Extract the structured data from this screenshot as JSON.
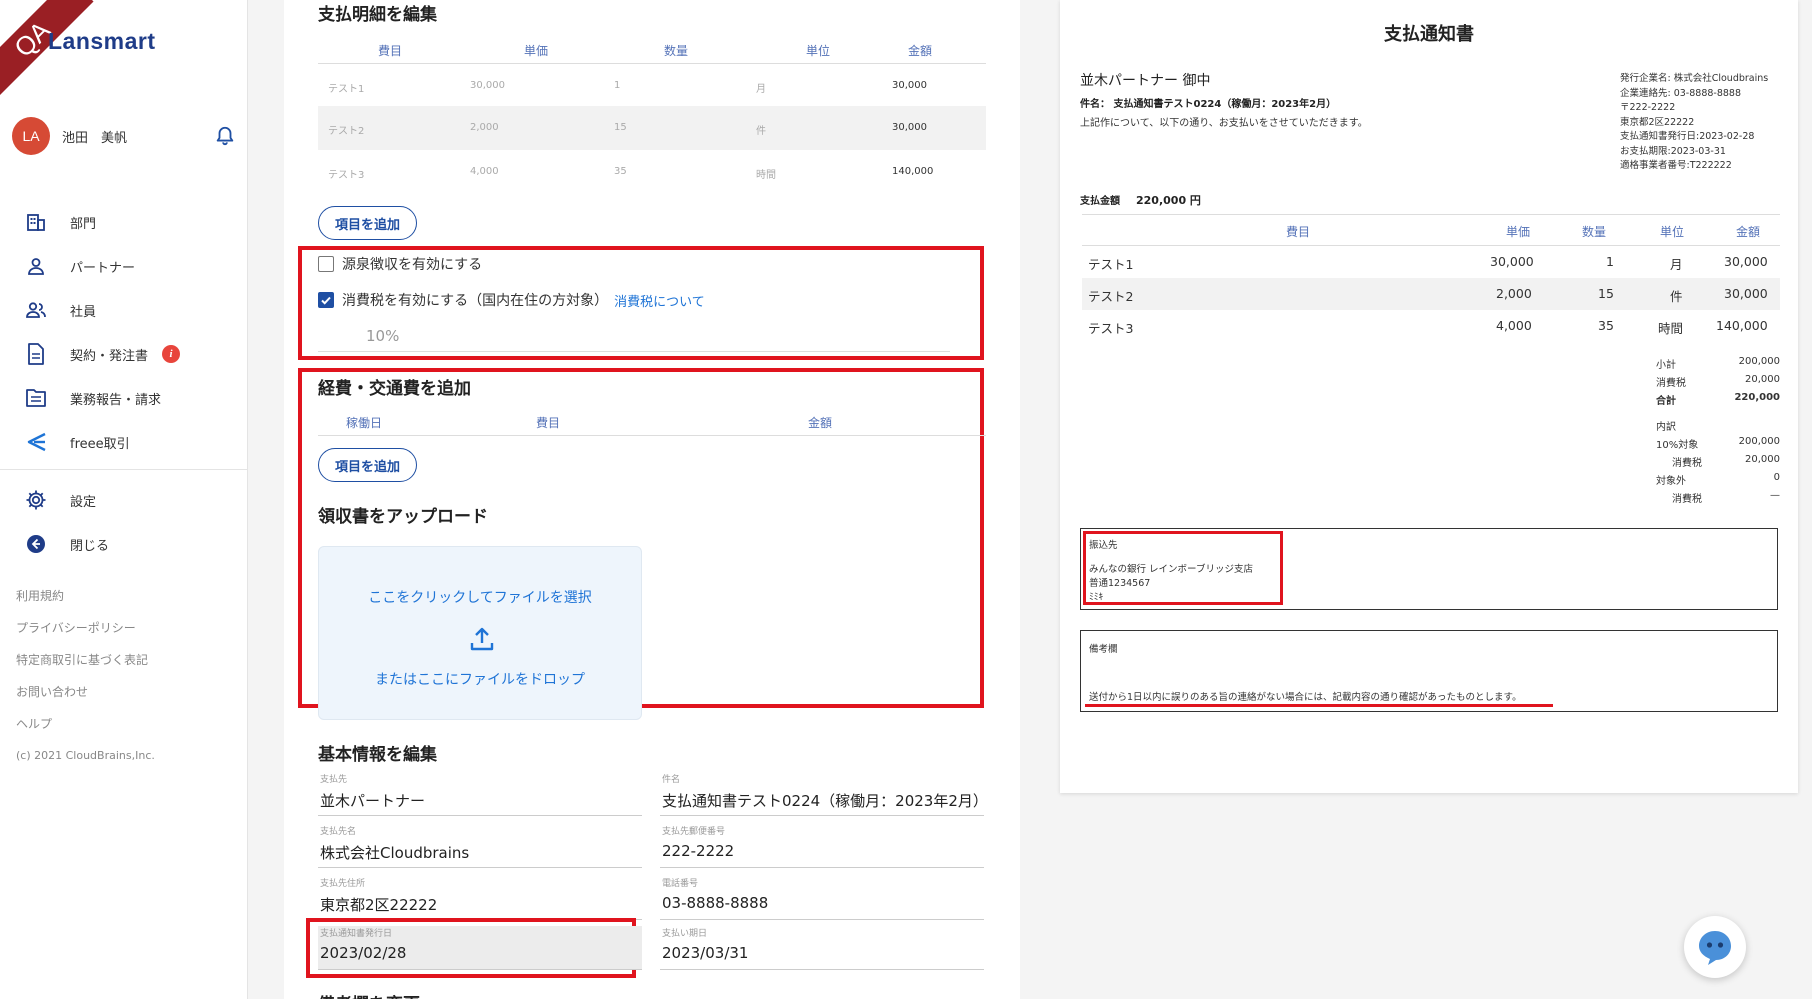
{
  "sidebar": {
    "qa_ribbon": "QA",
    "logo": "Lansmart",
    "user": {
      "initials": "LA",
      "name": "池田　美帆"
    },
    "nav": [
      {
        "label": "部門",
        "icon": "building-icon"
      },
      {
        "label": "パートナー",
        "icon": "person-icon"
      },
      {
        "label": "社員",
        "icon": "people-icon"
      },
      {
        "label": "契約・発注書",
        "icon": "document-icon",
        "badge": "i"
      },
      {
        "label": "業務報告・請求",
        "icon": "report-icon"
      },
      {
        "label": "freee取引",
        "icon": "freee-icon"
      }
    ],
    "nav2": [
      {
        "label": "設定",
        "icon": "gear-icon"
      },
      {
        "label": "閉じる",
        "icon": "collapse-icon"
      }
    ],
    "footer_links": [
      "利用規約",
      "プライバシーポリシー",
      "特定商取引に基づく表記",
      "お問い合わせ",
      "ヘルプ"
    ],
    "copyright": "(c) 2021 CloudBrains,Inc."
  },
  "form": {
    "items_title": "支払明細を編集",
    "items_headers": [
      "費目",
      "単価",
      "数量",
      "単位",
      "金額"
    ],
    "items": [
      {
        "name": "テスト1",
        "price": "30,000",
        "qty": "1",
        "unit": "月",
        "amount": "30,000"
      },
      {
        "name": "テスト2",
        "price": "2,000",
        "qty": "15",
        "unit": "件",
        "amount": "30,000"
      },
      {
        "name": "テスト3",
        "price": "4,000",
        "qty": "35",
        "unit": "時間",
        "amount": "140,000"
      }
    ],
    "add_item_label": "項目を追加",
    "withholding_label": "源泉徴収を有効にする",
    "withholding_checked": false,
    "consumption_tax_label": "消費税を有効にする（国内在住の方対象）",
    "consumption_tax_checked": true,
    "consumption_tax_link": "消費税について",
    "tax_rate": "10%",
    "expenses_title": "経費・交通費を追加",
    "expenses_headers": [
      "稼働日",
      "費目",
      "金額"
    ],
    "add_expense_label": "項目を追加",
    "receipt_title": "領収書をアップロード",
    "upload_click_text": "ここをクリックしてファイルを選択",
    "upload_drop_text": "またはここにファイルをドロップ",
    "basic_title": "基本情報を編集",
    "fields": {
      "payee": {
        "label": "支払先",
        "value": "並木パートナー"
      },
      "subject": {
        "label": "件名",
        "value": "支払通知書テスト0224（稼働月：2023年2月）"
      },
      "payee_name": {
        "label": "支払先名",
        "value": "株式会社Cloudbrains"
      },
      "postal": {
        "label": "支払先郵便番号",
        "value": "222-2222"
      },
      "address": {
        "label": "支払先住所",
        "value": "東京都2区22222"
      },
      "phone": {
        "label": "電話番号",
        "value": "03-8888-8888"
      },
      "issue_date": {
        "label": "支払通知書発行日",
        "value": "2023/02/28"
      },
      "due_date": {
        "label": "支払い期日",
        "value": "2023/03/31"
      }
    },
    "cut_title": "備考欄を変更"
  },
  "preview": {
    "title": "支払通知書",
    "to": "並木パートナー 御中",
    "subject": "件名： 支払通知書テスト0224（稼働月：2023年2月）",
    "intro": "上記作について、以下の通り、お支払いをさせていただきます。",
    "issuer": [
      "発行企業名: 株式会社Cloudbrains",
      "企業連絡先: 03-8888-8888",
      "〒222-2222",
      "東京都2区22222",
      "支払通知書発行日:2023-02-28",
      "お支払期限:2023-03-31",
      "適格事業者番号:T222222"
    ],
    "pay_label": "支払金額",
    "pay_amount": "220,000 円",
    "headers": [
      "費目",
      "単価",
      "数量",
      "単位",
      "金額"
    ],
    "rows": [
      {
        "name": "テスト1",
        "price": "30,000",
        "qty": "1",
        "unit": "月",
        "amount": "30,000"
      },
      {
        "name": "テスト2",
        "price": "2,000",
        "qty": "15",
        "unit": "件",
        "amount": "30,000"
      },
      {
        "name": "テスト3",
        "price": "4,000",
        "qty": "35",
        "unit": "時間",
        "amount": "140,000"
      }
    ],
    "sums": {
      "subtotal_label": "小計",
      "subtotal": "200,000",
      "tax_label": "消費税",
      "tax": "20,000",
      "total_label": "合計",
      "total": "220,000",
      "breakdown_label": "内訳",
      "r10_label": "10%対象",
      "r10": "200,000",
      "r10_tax_label": "消費税",
      "r10_tax": "20,000",
      "exempt_label": "対象外",
      "exempt": "0",
      "exempt_tax_label": "消費税",
      "exempt_tax": "—"
    },
    "bank": {
      "label": "振込先",
      "line1": "みんなの銀行 レインボーブリッジ支店",
      "line2": "普通1234567",
      "line3": "ﾐﾐｷ"
    },
    "note": {
      "label": "備考欄",
      "text": "送付から1日以内に誤りのある旨の連絡がない場合には、記載内容の通り確認があったものとします。"
    }
  },
  "colors": {
    "accent": "#1f4fa3",
    "highlight": "#e0141e",
    "ribbon": "#9a1f24"
  }
}
